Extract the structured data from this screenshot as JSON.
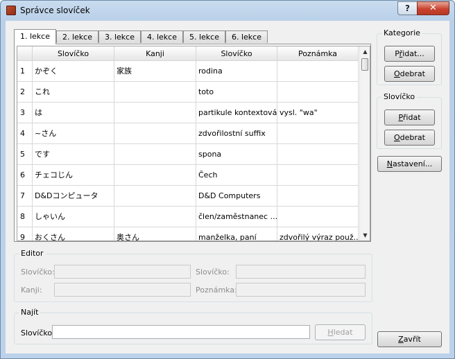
{
  "window": {
    "title": "Správce slovíček",
    "help_label": "?",
    "close_label": "✕"
  },
  "tabs": [
    "1. lekce",
    "2. lekce",
    "3. lekce",
    "4. lekce",
    "5. lekce",
    "6. lekce"
  ],
  "table": {
    "columns": [
      "Slovíčko",
      "Kanji",
      "Slovíčko",
      "Poznámka"
    ],
    "rows": [
      {
        "num": "1",
        "cells": [
          "かぞく",
          "家族",
          "rodina",
          ""
        ]
      },
      {
        "num": "2",
        "cells": [
          "これ",
          "",
          "toto",
          ""
        ]
      },
      {
        "num": "3",
        "cells": [
          "は",
          "",
          "partikule kontextová",
          "vysl. \"wa\""
        ]
      },
      {
        "num": "4",
        "cells": [
          "~さん",
          "",
          "zdvořilostní suffix",
          ""
        ]
      },
      {
        "num": "5",
        "cells": [
          "です",
          "",
          "spona",
          ""
        ]
      },
      {
        "num": "6",
        "cells": [
          "チェコじん",
          "",
          "Čech",
          ""
        ]
      },
      {
        "num": "7",
        "cells": [
          "D&Dコンピュータ",
          "",
          "D&D Computers",
          ""
        ]
      },
      {
        "num": "8",
        "cells": [
          "しゃいん",
          "",
          "člen/zaměstnanec ...",
          ""
        ]
      },
      {
        "num": "9",
        "cells": [
          "おくさん",
          "奥さん",
          "manželka, paní",
          "zdvořilý výraz použ..."
        ]
      }
    ]
  },
  "kategorie": {
    "title": "Kategorie",
    "add_pre": "P",
    "add_u": "ř",
    "add_post": "idat...",
    "remove_pre": "",
    "remove_u": "O",
    "remove_post": "debrat"
  },
  "slovicko_group": {
    "title": "Slovíčko",
    "add_pre": "",
    "add_u": "P",
    "add_post": "řidat",
    "remove_pre": "",
    "remove_u": "O",
    "remove_post": "debrat"
  },
  "settings": {
    "pre": "",
    "u": "N",
    "post": "astavení..."
  },
  "editor": {
    "title": "Editor",
    "slovicko1_label": "Slovíčko:",
    "slovicko2_label": "Slovíčko:",
    "kanji_label": "Kanji:",
    "poznamka_label": "Poznámka:"
  },
  "search": {
    "title": "Najít",
    "label": "Slovíčko",
    "value": "",
    "button_pre": "",
    "button_u": "H",
    "button_post": "ledat"
  },
  "close_button": {
    "pre": "",
    "u": "Z",
    "post": "avřít"
  }
}
